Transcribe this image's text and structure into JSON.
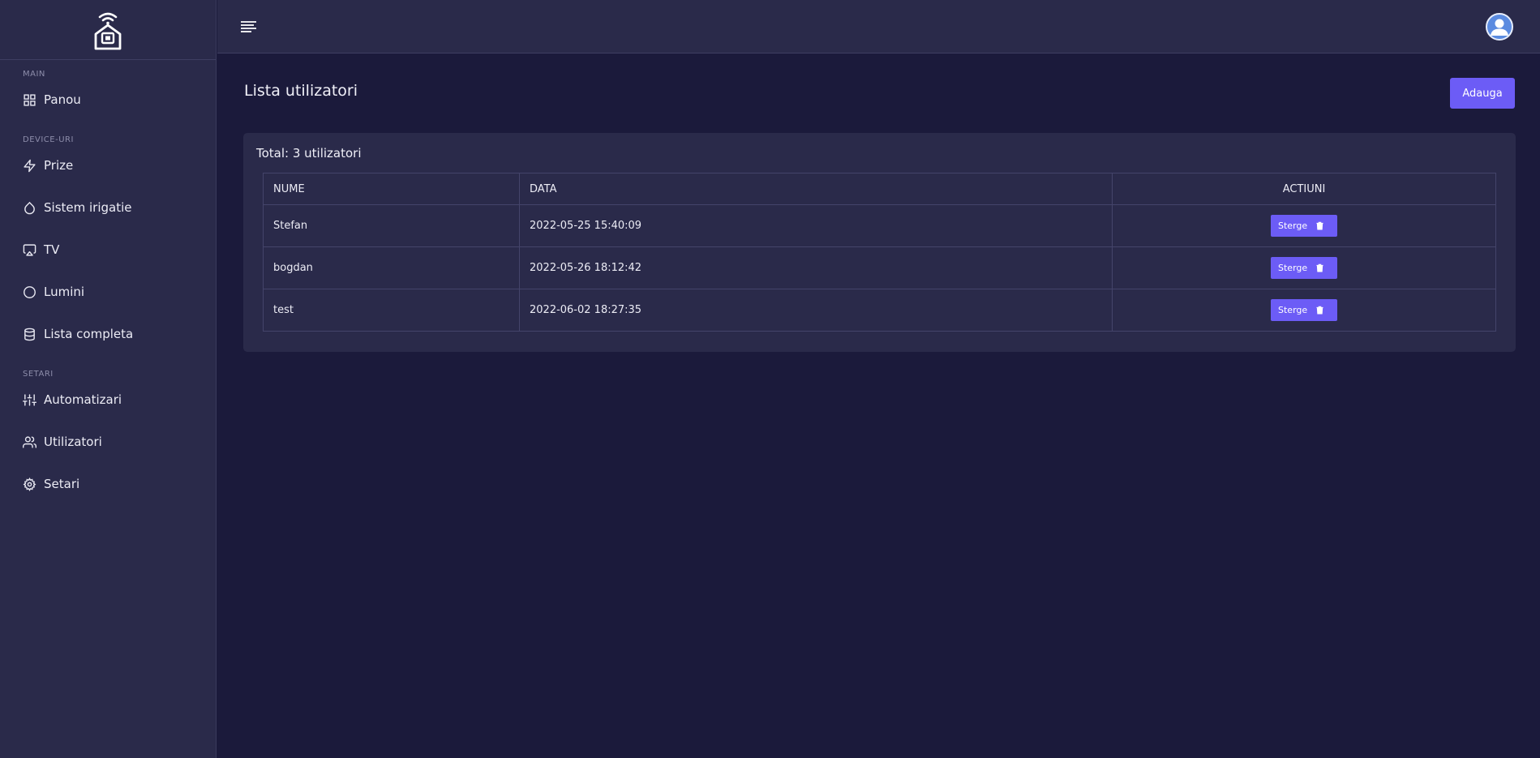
{
  "sidebar": {
    "sections": [
      {
        "label": "MAIN",
        "items": [
          {
            "label": "Panou",
            "icon": "grid-icon"
          }
        ]
      },
      {
        "label": "DEVICE-URI",
        "items": [
          {
            "label": "Prize",
            "icon": "bolt-icon"
          },
          {
            "label": "Sistem irigatie",
            "icon": "droplet-icon"
          },
          {
            "label": "TV",
            "icon": "tv-icon"
          },
          {
            "label": "Lumini",
            "icon": "circle-icon"
          },
          {
            "label": "Lista completa",
            "icon": "database-icon"
          }
        ]
      },
      {
        "label": "SETARI",
        "items": [
          {
            "label": "Automatizari",
            "icon": "sliders-icon"
          },
          {
            "label": "Utilizatori",
            "icon": "users-icon"
          },
          {
            "label": "Setari",
            "icon": "gear-icon"
          }
        ]
      }
    ]
  },
  "main": {
    "title": "Lista utilizatori",
    "add_label": "Adauga",
    "total": "Total: 3 utilizatori",
    "table": {
      "headers": [
        "NUME",
        "DATA",
        "ACTIUNI"
      ],
      "rows": [
        {
          "name": "Stefan",
          "date": "2022-05-25 15:40:09",
          "action": "Sterge"
        },
        {
          "name": "bogdan",
          "date": "2022-05-26 18:12:42",
          "action": "Sterge"
        },
        {
          "name": "test",
          "date": "2022-06-02 18:27:35",
          "action": "Sterge"
        }
      ]
    }
  },
  "colors": {
    "accent": "#6c5cf6",
    "background": "#1b1a3b",
    "panel": "#2a2a4a"
  }
}
